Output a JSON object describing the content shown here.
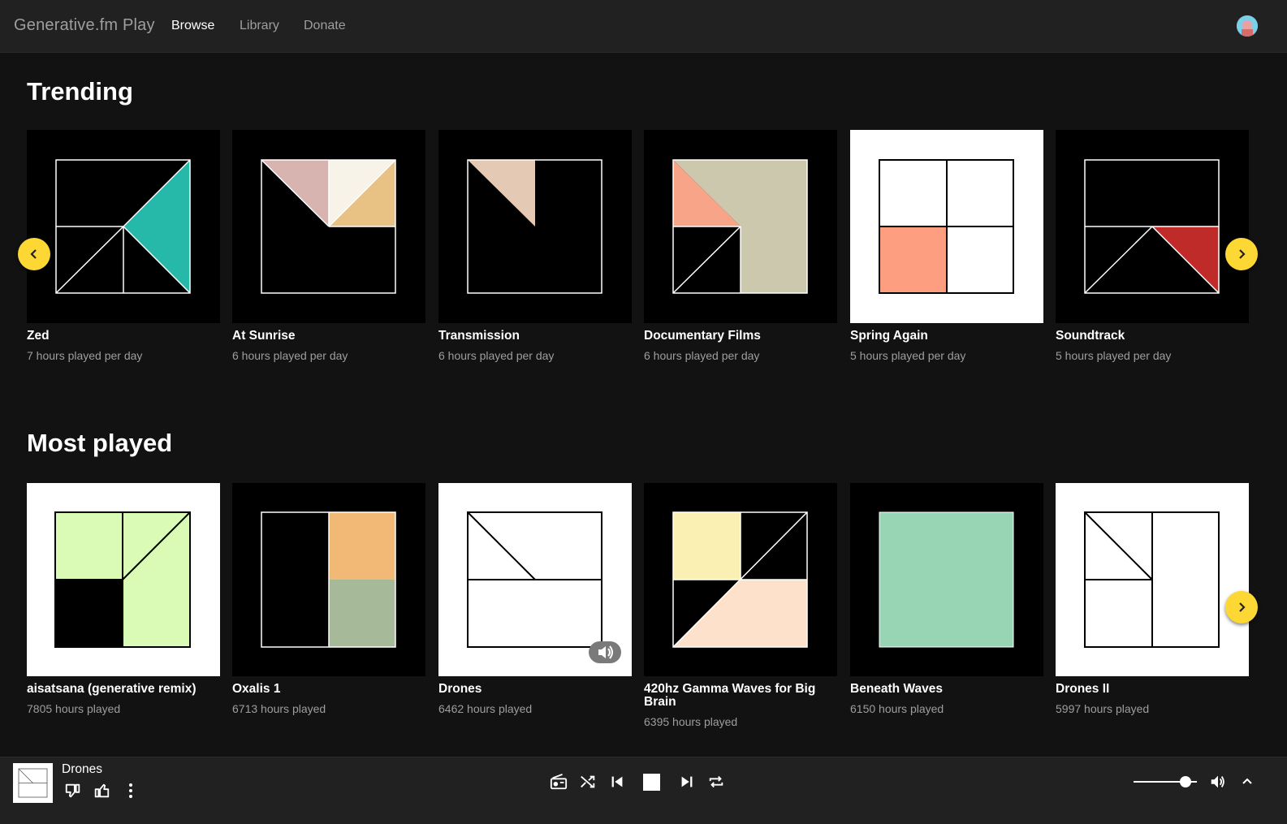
{
  "app": {
    "brand": "Generative.fm Play"
  },
  "nav": {
    "browse": "Browse",
    "library": "Library",
    "donate": "Donate"
  },
  "trending": {
    "heading": "Trending",
    "cards": [
      {
        "title": "Zed",
        "stat": "7 hours played per day"
      },
      {
        "title": "At Sunrise",
        "stat": "6 hours played per day"
      },
      {
        "title": "Transmission",
        "stat": "6 hours played per day"
      },
      {
        "title": "Documentary Films",
        "stat": "6 hours played per day"
      },
      {
        "title": "Spring Again",
        "stat": "5 hours played per day"
      },
      {
        "title": "Soundtrack",
        "stat": "5 hours played per day"
      }
    ]
  },
  "most_played": {
    "heading": "Most played",
    "cards": [
      {
        "title": "aisatsana (generative remix)",
        "stat": "7805 hours played"
      },
      {
        "title": "Oxalis 1",
        "stat": "6713 hours played"
      },
      {
        "title": "Drones",
        "stat": "6462 hours played"
      },
      {
        "title": "420hz Gamma Waves for Big Brain",
        "stat": "6395 hours played"
      },
      {
        "title": "Beneath Waves",
        "stat": "6150 hours played"
      },
      {
        "title": "Drones II",
        "stat": "5997 hours played"
      }
    ]
  },
  "player": {
    "track": "Drones",
    "volume": 0.82,
    "icons": [
      "thumbs-down-icon",
      "thumbs-up-icon",
      "more-vert-icon",
      "radio-icon",
      "shuffle-icon",
      "previous-icon",
      "stop-icon",
      "next-icon",
      "repeat-icon",
      "volume-icon",
      "chevron-up-icon"
    ]
  },
  "colors": {
    "accent": "#fdd835",
    "background": "#121212",
    "bar": "#212121",
    "zed": "#26b8a8",
    "spring_again": "#fd9e80",
    "soundtrack": "#be2b29",
    "beneath_waves": "#98d5b4"
  }
}
